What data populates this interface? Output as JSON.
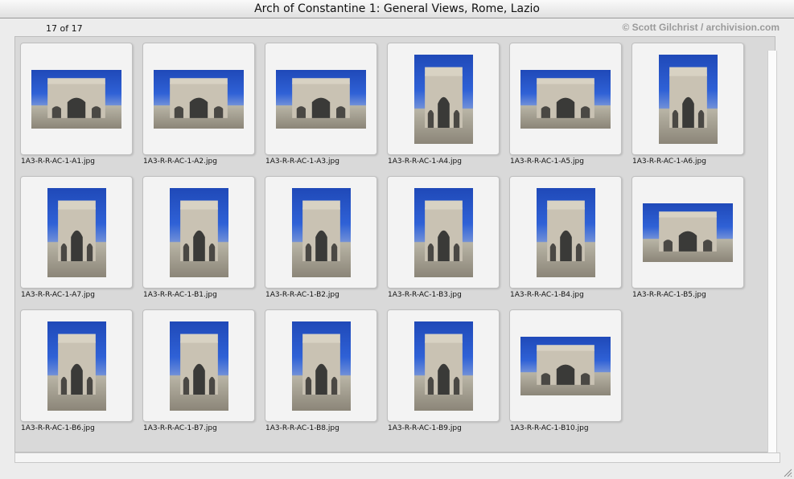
{
  "window": {
    "title": "Arch of Constantine 1: General Views, Rome, Lazio"
  },
  "status": {
    "counter": "17 of 17",
    "credit": "© Scott Gilchrist / archivision.com"
  },
  "colors": {
    "sky": "#2f61d6",
    "stone": "#c9c2b3",
    "panel": "#d9d9d9"
  },
  "files": [
    {
      "name": "1A3-R-R-AC-1-A1.jpg",
      "orientation": "landscape"
    },
    {
      "name": "1A3-R-R-AC-1-A2.jpg",
      "orientation": "landscape"
    },
    {
      "name": "1A3-R-R-AC-1-A3.jpg",
      "orientation": "landscape"
    },
    {
      "name": "1A3-R-R-AC-1-A4.jpg",
      "orientation": "portrait"
    },
    {
      "name": "1A3-R-R-AC-1-A5.jpg",
      "orientation": "landscape"
    },
    {
      "name": "1A3-R-R-AC-1-A6.jpg",
      "orientation": "portrait"
    },
    {
      "name": "1A3-R-R-AC-1-A7.jpg",
      "orientation": "portrait"
    },
    {
      "name": "1A3-R-R-AC-1-B1.jpg",
      "orientation": "portrait"
    },
    {
      "name": "1A3-R-R-AC-1-B2.jpg",
      "orientation": "portrait"
    },
    {
      "name": "1A3-R-R-AC-1-B3.jpg",
      "orientation": "portrait"
    },
    {
      "name": "1A3-R-R-AC-1-B4.jpg",
      "orientation": "portrait"
    },
    {
      "name": "1A3-R-R-AC-1-B5.jpg",
      "orientation": "landscape"
    },
    {
      "name": "1A3-R-R-AC-1-B6.jpg",
      "orientation": "portrait"
    },
    {
      "name": "1A3-R-R-AC-1-B7.jpg",
      "orientation": "portrait"
    },
    {
      "name": "1A3-R-R-AC-1-B8.jpg",
      "orientation": "portrait"
    },
    {
      "name": "1A3-R-R-AC-1-B9.jpg",
      "orientation": "portrait"
    },
    {
      "name": "1A3-R-R-AC-1-B10.jpg",
      "orientation": "landscape"
    }
  ]
}
